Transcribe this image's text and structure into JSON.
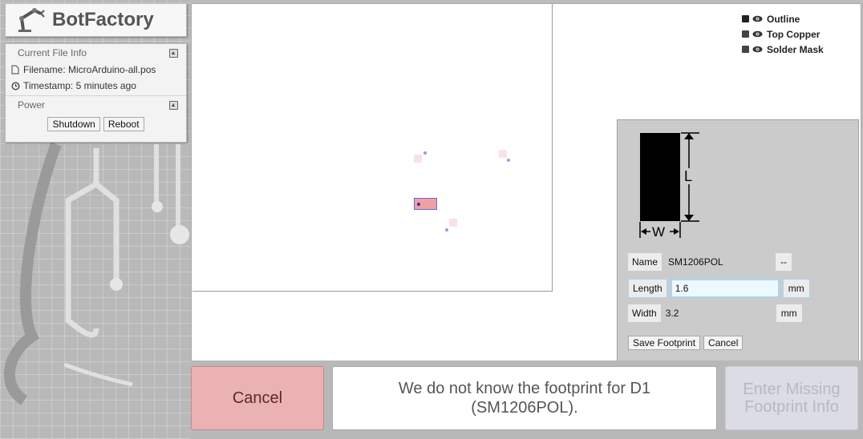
{
  "brand": {
    "title": "BotFactory",
    "logo_icon": "robot-arm-icon"
  },
  "file_info": {
    "section_title": "Current File Info",
    "filename_label": "Filename: MicroArduino-all.pos",
    "timestamp_label": "Timestamp: 5 minutes ago"
  },
  "power": {
    "section_title": "Power",
    "shutdown_label": "Shutdown",
    "reboot_label": "Reboot"
  },
  "layers": [
    {
      "label": "Outline",
      "color": "#222222",
      "visible": true
    },
    {
      "label": "Top Copper",
      "color": "#444444",
      "visible": true
    },
    {
      "label": "Solder Mask",
      "color": "#444444",
      "visible": true
    }
  ],
  "footprint": {
    "diagram": {
      "length_symbol": "L",
      "width_symbol": "W"
    },
    "name_label": "Name",
    "name_value": "SM1206POL",
    "name_unit": "--",
    "length_label": "Length",
    "length_value": "1.6",
    "length_unit": "mm",
    "width_label": "Width",
    "width_value": "3.2",
    "width_unit": "mm",
    "save_label": "Save Footprint",
    "cancel_label": "Cancel"
  },
  "actions": {
    "cancel_label": "Cancel",
    "message": "We do not know the footprint for D1 (SM1206POL).",
    "enter_label": "Enter Missing Footprint Info"
  },
  "colors": {
    "cancel_bg": "#eab2b2",
    "selected_pad": "#f0a0a0",
    "input_focus": "#a9d4f4"
  }
}
